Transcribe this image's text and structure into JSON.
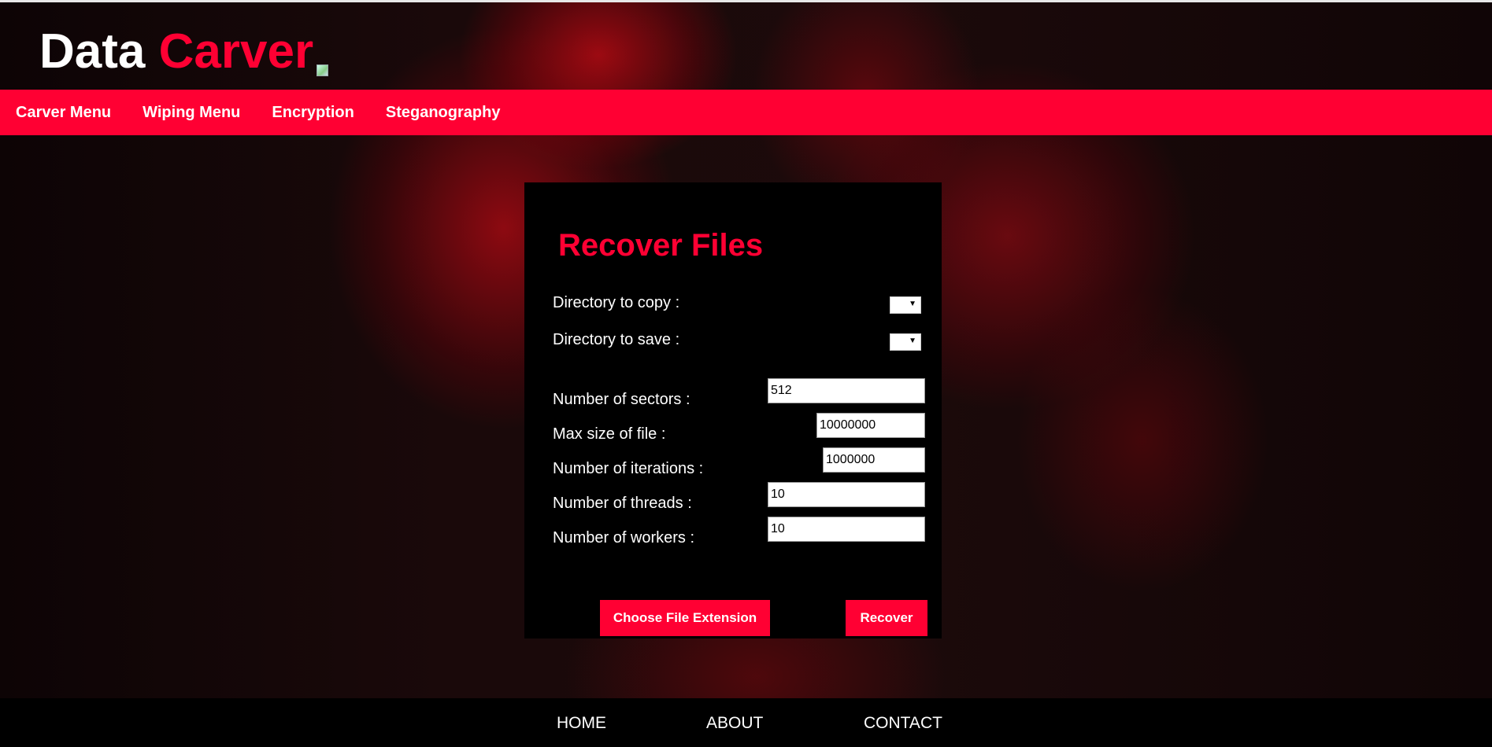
{
  "header": {
    "title_part1": "Data ",
    "title_part2": "Carver"
  },
  "nav": {
    "items": [
      "Carver Menu",
      "Wiping Menu",
      "Encryption",
      "Steganography"
    ]
  },
  "form": {
    "title": "Recover Files",
    "copy_dir_label": "Directory to copy :",
    "save_dir_label": "Directory to save :",
    "sectors_label": "Number of sectors :",
    "sectors_value": "512",
    "max_size_label": "Max size of file :",
    "max_size_value": "10000000",
    "iterations_label": "Number of iterations :",
    "iterations_value": "1000000",
    "threads_label": "Number of threads :",
    "threads_value": "10",
    "workers_label": "Number of workers :",
    "workers_value": "10",
    "choose_ext_button": "Choose File Extension",
    "recover_button": "Recover"
  },
  "footer": {
    "home": "HOME",
    "about": "ABOUT",
    "contact": "CONTACT"
  },
  "colors": {
    "accent": "#ff0033",
    "panel": "#000000"
  }
}
